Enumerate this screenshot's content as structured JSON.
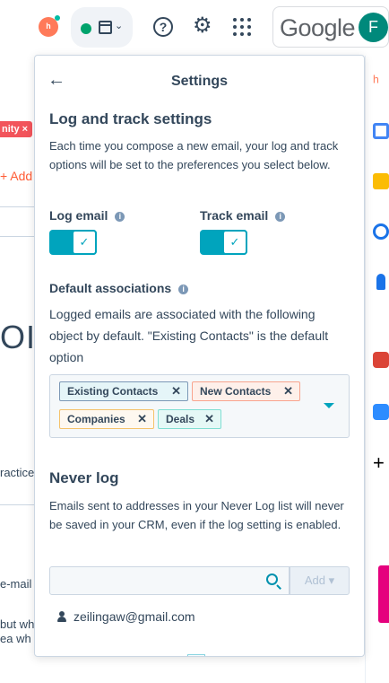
{
  "topbar": {
    "hubspot_logo": "hubspot-sprocket-icon",
    "google_wordmark": "Google",
    "avatar_letter": "F",
    "colors": {
      "hubspot": "#ff7a59",
      "status_online": "#00a36c",
      "avatar": "#00897b"
    }
  },
  "background": {
    "tag_text": "nity ×",
    "add_text": "+ Add",
    "big_text": "OI",
    "practices_text": "ractices",
    "email_text": "e-mail",
    "but_text": "but wh",
    "idea_text": "ea wh"
  },
  "panel": {
    "title": "Settings",
    "log_track": {
      "heading": "Log and track settings",
      "description": "Each time you compose a new email, your log and track options will be set to the preferences you select below.",
      "log_email_label": "Log email",
      "track_email_label": "Track email",
      "log_email_on": true,
      "track_email_on": true
    },
    "associations": {
      "heading": "Default associations",
      "description": "Logged emails are associated with the following object by default. \"Existing Contacts\" is the default option",
      "chips": [
        "Existing Contacts",
        "New Contacts",
        "Companies",
        "Deals"
      ]
    },
    "never_log": {
      "heading": "Never log",
      "description": "Emails sent to addresses in your Never Log list will never be saved in your CRM, even if the log setting is enabled.",
      "search_placeholder": "",
      "add_label": "Add",
      "entries": [
        "zeilingaw@gmail.com"
      ]
    },
    "accent_color": "#00a4bd"
  }
}
